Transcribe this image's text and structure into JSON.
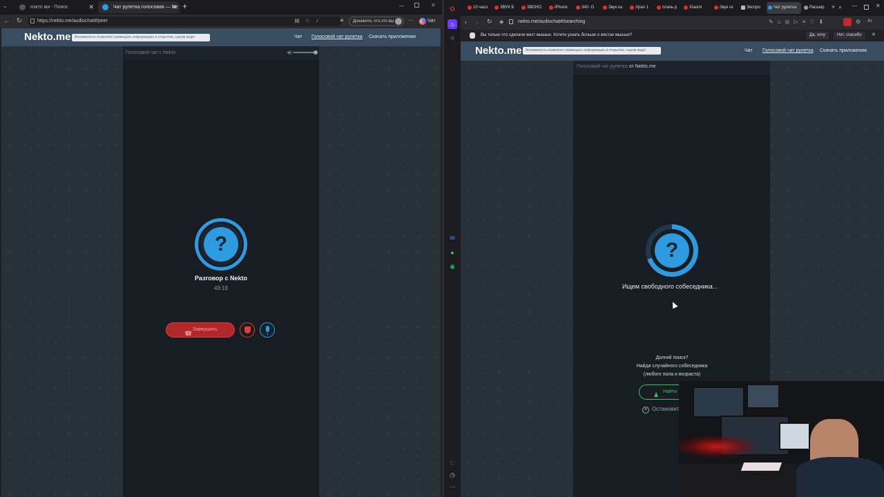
{
  "left_browser": {
    "tabs": [
      {
        "title": "нэкто ми - Поиск",
        "active": false
      },
      {
        "title": "Чат рулетка голосовая — Ne",
        "active": true
      }
    ],
    "new_tab": "+",
    "url": "https://nekto.me/audiochat#/peer",
    "prove_text": "Докажите, что это вы",
    "copilot_label": "Чат",
    "site": {
      "logo": "Nekto.me",
      "notice": "Анонимность позволяет размещать информацию в открытом, сыром виде!",
      "nav": [
        "Чат",
        "Голосовой чат рулетка",
        "Скачать приложения"
      ],
      "sub_header": "Голосовой чат с Nekto"
    },
    "call": {
      "question_mark": "?",
      "title": "Разговор с Nekto",
      "timer": "49:18",
      "end_button": "Завершить"
    }
  },
  "right_browser": {
    "tabs": [
      "10 часо",
      "ЗВУК Б",
      "ЗВОНО",
      "iPhone",
      "340. О",
      "Звук ка",
      "Храп 1",
      "плачь р",
      "Xiaomi",
      "Звук ск",
      "Экспро",
      "Чат рулетка",
      "Расшир"
    ],
    "url": "nekto.me/audiochat#/searching",
    "info_bar": {
      "message": "Вы только что сделали жест мышью. Хотите узнать больше о жестах мышью?",
      "yes": "Да, хочу",
      "no": "Нет, спасибо"
    },
    "site": {
      "logo": "Nekto.me",
      "notice": "Анонимность позволяет размещать информацию в открытом, сыром виде!",
      "nav": [
        "Чат",
        "Голосовой чат рулетка",
        "Скачать приложения"
      ],
      "sub_header_prefix": "Голосовой чат рулетка",
      "sub_header_suffix": "от Nekto.me"
    },
    "search": {
      "question_mark": "?",
      "status": "Ищем свободного собеседника...",
      "long_search": "Долгий поиск?",
      "hint_line1": "Найди случайного собеседника",
      "hint_line2": "(любого пола и возраста)",
      "find_button": "Найти",
      "stop_label": "Остановить"
    }
  },
  "colors": {
    "accent_blue": "#2e9be0",
    "end_red": "#e23c3c",
    "find_green": "#40c060",
    "header_bg": "#3a4d60",
    "panel_bg": "#181d23"
  }
}
